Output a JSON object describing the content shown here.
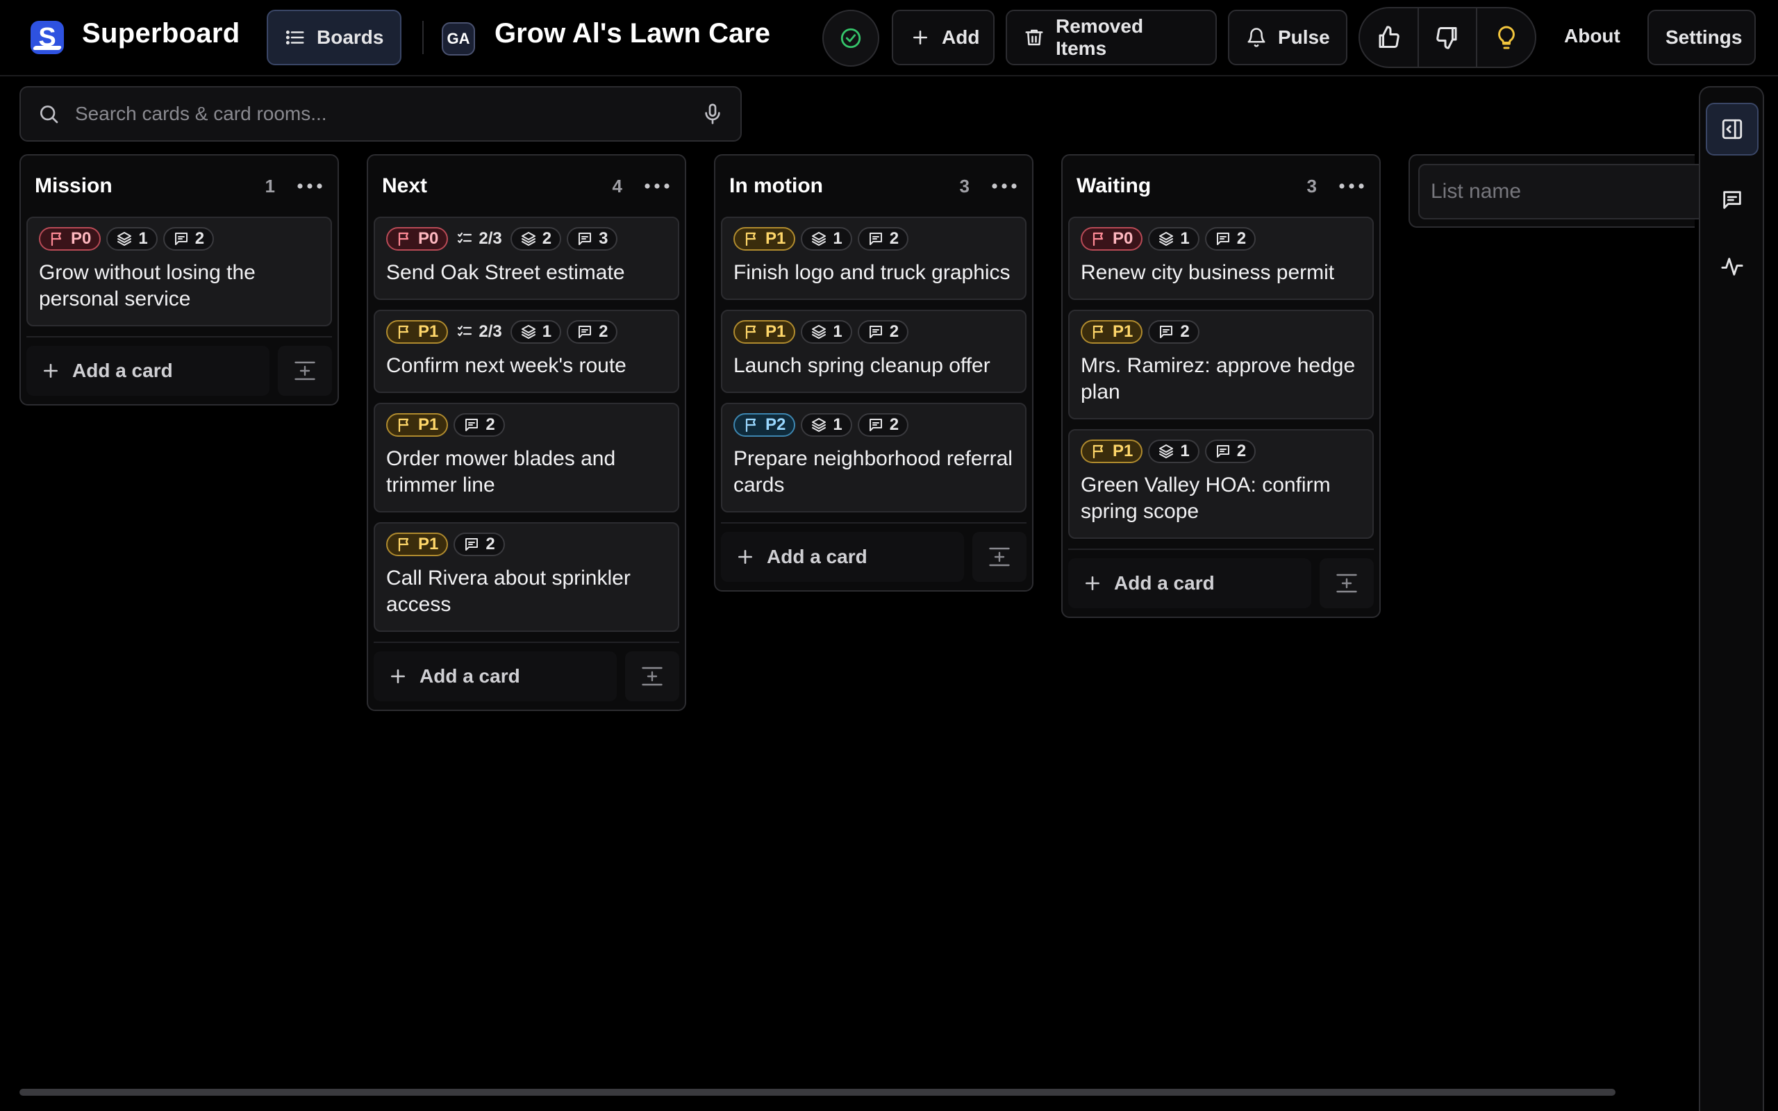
{
  "app": {
    "name": "Superboard",
    "logo_letter": "S"
  },
  "header": {
    "boards_label": "Boards",
    "board_initials": "GA",
    "board_title": "Grow Al's Lawn Care",
    "add_label": "Add",
    "removed_label": "Removed Items",
    "pulse_label": "Pulse",
    "about_label": "About",
    "settings_label": "Settings"
  },
  "search": {
    "placeholder": "Search cards & card rooms..."
  },
  "lists": [
    {
      "title": "Mission",
      "count": "1",
      "cards": [
        {
          "priority": "P0",
          "checklist": "",
          "layers": "1",
          "comments": "2",
          "title": "Grow without losing the personal service"
        }
      ]
    },
    {
      "title": "Next",
      "count": "4",
      "cards": [
        {
          "priority": "P0",
          "checklist": "2/3",
          "layers": "2",
          "comments": "3",
          "title": "Send Oak Street estimate"
        },
        {
          "priority": "P1",
          "checklist": "2/3",
          "layers": "1",
          "comments": "2",
          "title": "Confirm next week's route"
        },
        {
          "priority": "P1",
          "checklist": "",
          "layers": "",
          "comments": "2",
          "title": "Order mower blades and trimmer line"
        },
        {
          "priority": "P1",
          "checklist": "",
          "layers": "",
          "comments": "2",
          "title": "Call Rivera about sprinkler access"
        }
      ]
    },
    {
      "title": "In motion",
      "count": "3",
      "cards": [
        {
          "priority": "P1",
          "checklist": "",
          "layers": "1",
          "comments": "2",
          "title": "Finish logo and truck graphics"
        },
        {
          "priority": "P1",
          "checklist": "",
          "layers": "1",
          "comments": "2",
          "title": "Launch spring cleanup offer"
        },
        {
          "priority": "P2",
          "checklist": "",
          "layers": "1",
          "comments": "2",
          "title": "Prepare neighborhood referral cards"
        }
      ]
    },
    {
      "title": "Waiting",
      "count": "3",
      "cards": [
        {
          "priority": "P0",
          "checklist": "",
          "layers": "1",
          "comments": "2",
          "title": "Renew city business permit"
        },
        {
          "priority": "P1",
          "checklist": "",
          "layers": "",
          "comments": "2",
          "title": "Mrs. Ramirez: approve hedge plan"
        },
        {
          "priority": "P1",
          "checklist": "",
          "layers": "1",
          "comments": "2",
          "title": "Green Valley HOA: confirm spring scope"
        }
      ]
    }
  ],
  "add_card_label": "Add a card",
  "new_list": {
    "placeholder": "List name"
  },
  "icons": {
    "flag": "flag-icon",
    "checklist": "checklist-icon",
    "layers": "layers-icon",
    "comment": "comment-icon",
    "mic": "mic-icon",
    "search": "search-icon"
  },
  "colors": {
    "p0": "#ff8a96",
    "p1": "#ffd76a",
    "p2": "#9ad8ff",
    "status_ok": "#35c46a",
    "idea": "#f2c53d",
    "accent": "#2e52e0"
  }
}
